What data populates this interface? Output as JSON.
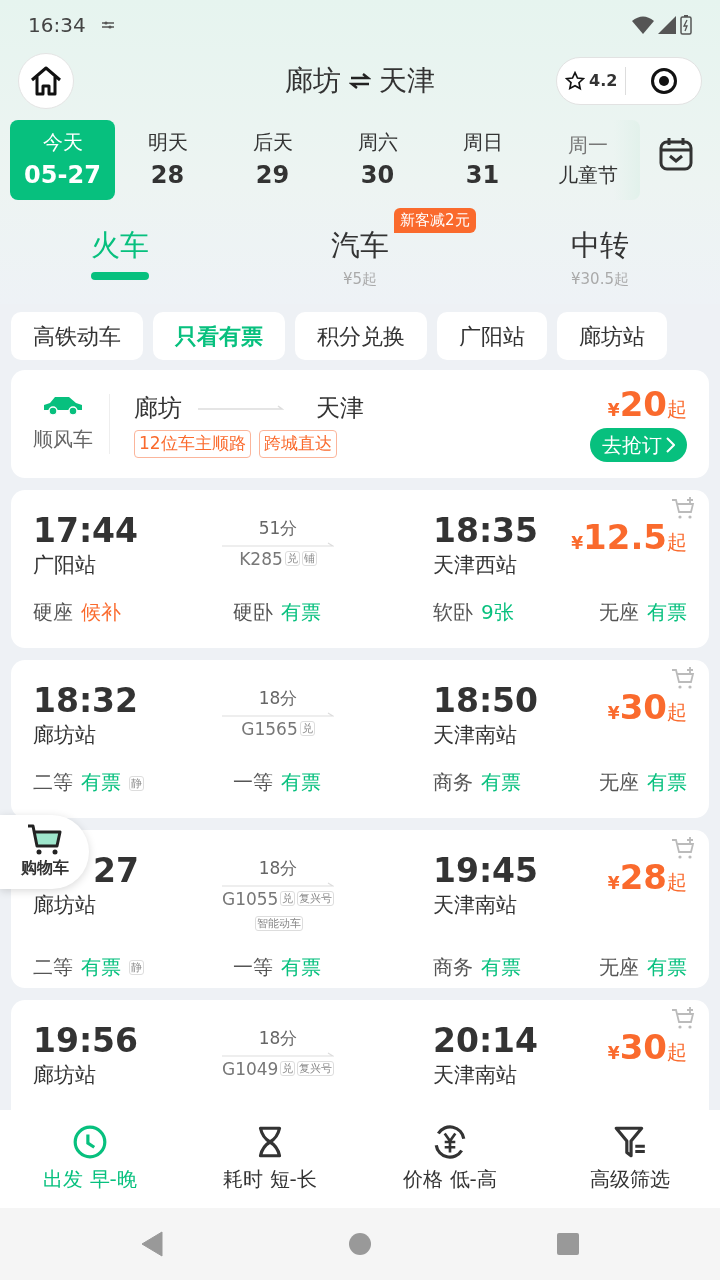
{
  "status_bar": {
    "time": "16:34"
  },
  "header": {
    "from": "廊坊",
    "to": "天津",
    "rating": "4.2"
  },
  "dates": [
    {
      "day": "今天",
      "date": "05-27",
      "selected": true
    },
    {
      "day": "明天",
      "date": "28",
      "selected": false
    },
    {
      "day": "后天",
      "date": "29",
      "selected": false
    },
    {
      "day": "周六",
      "date": "30",
      "selected": false
    },
    {
      "day": "周日",
      "date": "31",
      "selected": false
    },
    {
      "day": "周一",
      "date": "儿童节",
      "selected": false
    }
  ],
  "modes": [
    {
      "label": "火车",
      "selected": true
    },
    {
      "label": "汽车",
      "sub": "¥5起",
      "badge": "新客减2元",
      "selected": false
    },
    {
      "label": "中转",
      "sub": "¥30.5起",
      "selected": false
    }
  ],
  "filters": [
    {
      "label": "高铁动车",
      "selected": false
    },
    {
      "label": "只看有票",
      "selected": true
    },
    {
      "label": "积分兑换",
      "selected": false
    },
    {
      "label": "广阳站",
      "selected": false
    },
    {
      "label": "廊坊站",
      "selected": false
    }
  ],
  "carpool": {
    "label": "顺风车",
    "from": "廊坊",
    "to": "天津",
    "tags": [
      "12位车主顺路",
      "跨城直达"
    ],
    "price": {
      "currency": "¥",
      "amount": "20",
      "suffix": "起"
    },
    "button": "去抢订"
  },
  "trains": [
    {
      "depart": "17:44",
      "depart_station": "广阳站",
      "duration": "51分",
      "number": "K285",
      "tags": [
        "兑",
        "铺"
      ],
      "arrive": "18:35",
      "arrive_station": "天津西站",
      "price": {
        "currency": "¥",
        "amount": "12.5",
        "suffix": "起"
      },
      "seats": [
        {
          "class": "硬座",
          "availability": "候补",
          "available": false
        },
        {
          "class": "硬卧",
          "availability": "有票",
          "available": true
        },
        {
          "class": "软卧",
          "availability": "9张",
          "available": true
        },
        {
          "class": "无座",
          "availability": "有票",
          "available": true
        }
      ]
    },
    {
      "depart": "18:32",
      "depart_station": "廊坊站",
      "duration": "18分",
      "number": "G1565",
      "tags": [
        "兑"
      ],
      "arrive": "18:50",
      "arrive_station": "天津南站",
      "price": {
        "currency": "¥",
        "amount": "30",
        "suffix": "起"
      },
      "seats": [
        {
          "class": "二等",
          "availability": "有票",
          "available": true,
          "tag": "静"
        },
        {
          "class": "一等",
          "availability": "有票",
          "available": true
        },
        {
          "class": "商务",
          "availability": "有票",
          "available": true
        },
        {
          "class": "无座",
          "availability": "有票",
          "available": true
        }
      ]
    },
    {
      "depart": "27",
      "depart_station": "廊坊站",
      "duration": "18分",
      "number": "G1055",
      "tags": [
        "兑",
        "复兴号"
      ],
      "extra_tags": [
        "智能动车"
      ],
      "arrive": "19:45",
      "arrive_station": "天津南站",
      "price": {
        "currency": "¥",
        "amount": "28",
        "suffix": "起"
      },
      "seats": [
        {
          "class": "二等",
          "availability": "有票",
          "available": true,
          "tag": "静"
        },
        {
          "class": "一等",
          "availability": "有票",
          "available": true
        },
        {
          "class": "商务",
          "availability": "有票",
          "available": true
        },
        {
          "class": "无座",
          "availability": "有票",
          "available": true
        }
      ]
    },
    {
      "depart": "19:56",
      "depart_station": "廊坊站",
      "duration": "18分",
      "number": "G1049",
      "tags": [
        "兑",
        "复兴号"
      ],
      "arrive": "20:14",
      "arrive_station": "天津南站",
      "price": {
        "currency": "¥",
        "amount": "30",
        "suffix": "起"
      }
    }
  ],
  "cart_button": {
    "label": "购物车"
  },
  "sort_bar": [
    {
      "kind": "time",
      "label": "出发 早-晚",
      "selected": true
    },
    {
      "kind": "duration",
      "label": "耗时 短-长",
      "selected": false
    },
    {
      "kind": "price",
      "label": "价格 低-高",
      "selected": false
    },
    {
      "kind": "filter",
      "label": "高级筛选",
      "selected": false
    }
  ]
}
